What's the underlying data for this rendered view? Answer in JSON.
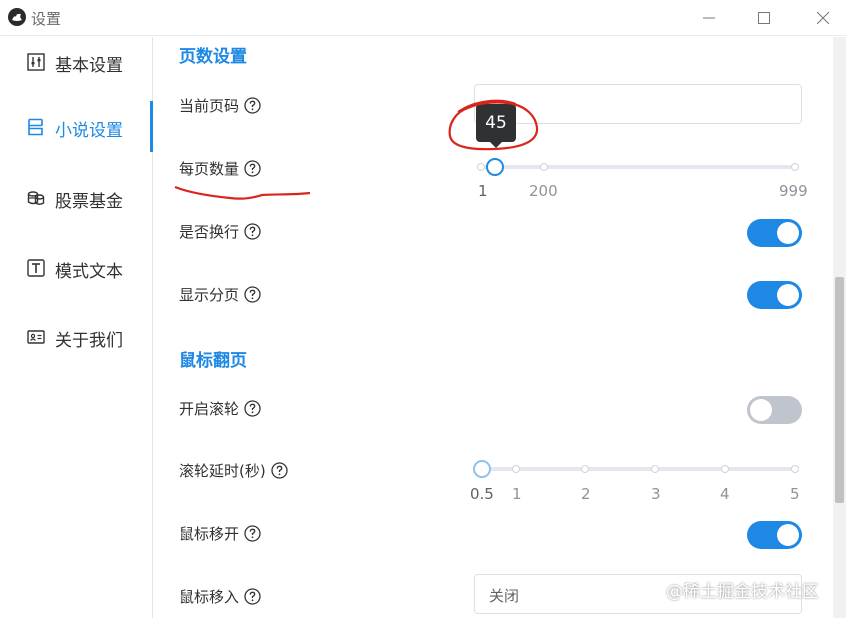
{
  "window": {
    "title": "设置"
  },
  "sidebar": {
    "items": [
      {
        "label": "基本设置",
        "icon": "sliders-icon",
        "active": false
      },
      {
        "label": "小说设置",
        "icon": "book-icon",
        "active": true
      },
      {
        "label": "股票基金",
        "icon": "coins-icon",
        "active": false
      },
      {
        "label": "模式文本",
        "icon": "text-box-icon",
        "active": false
      },
      {
        "label": "关于我们",
        "icon": "id-card-icon",
        "active": false
      }
    ]
  },
  "sections": {
    "page": {
      "title": "页数设置",
      "current_page": {
        "label": "当前页码",
        "value": ""
      },
      "per_page": {
        "label": "每页数量",
        "min": 1,
        "max": 999,
        "value": 45,
        "tooltip": "45",
        "ticks": [
          "1",
          "200",
          "999"
        ]
      },
      "wrap": {
        "label": "是否换行",
        "on": true
      },
      "show_paging": {
        "label": "显示分页",
        "on": true
      }
    },
    "mouse": {
      "title": "鼠标翻页",
      "wheel": {
        "label": "开启滚轮",
        "on": false
      },
      "wheel_delay": {
        "label": "滚轮延时(秒)",
        "min": 0.5,
        "max": 5,
        "value": 0.5,
        "ticks": [
          "0.5",
          "1",
          "2",
          "3",
          "4",
          "5"
        ]
      },
      "mouse_leave": {
        "label": "鼠标移开",
        "on": true
      },
      "mouse_enter": {
        "label": "鼠标移入",
        "value": "关闭"
      }
    }
  },
  "watermark": "@稀土掘金技术社区",
  "colors": {
    "accent": "#1e88e5",
    "annotation": "#d9261c",
    "switch_off": "#c0c4cc"
  }
}
